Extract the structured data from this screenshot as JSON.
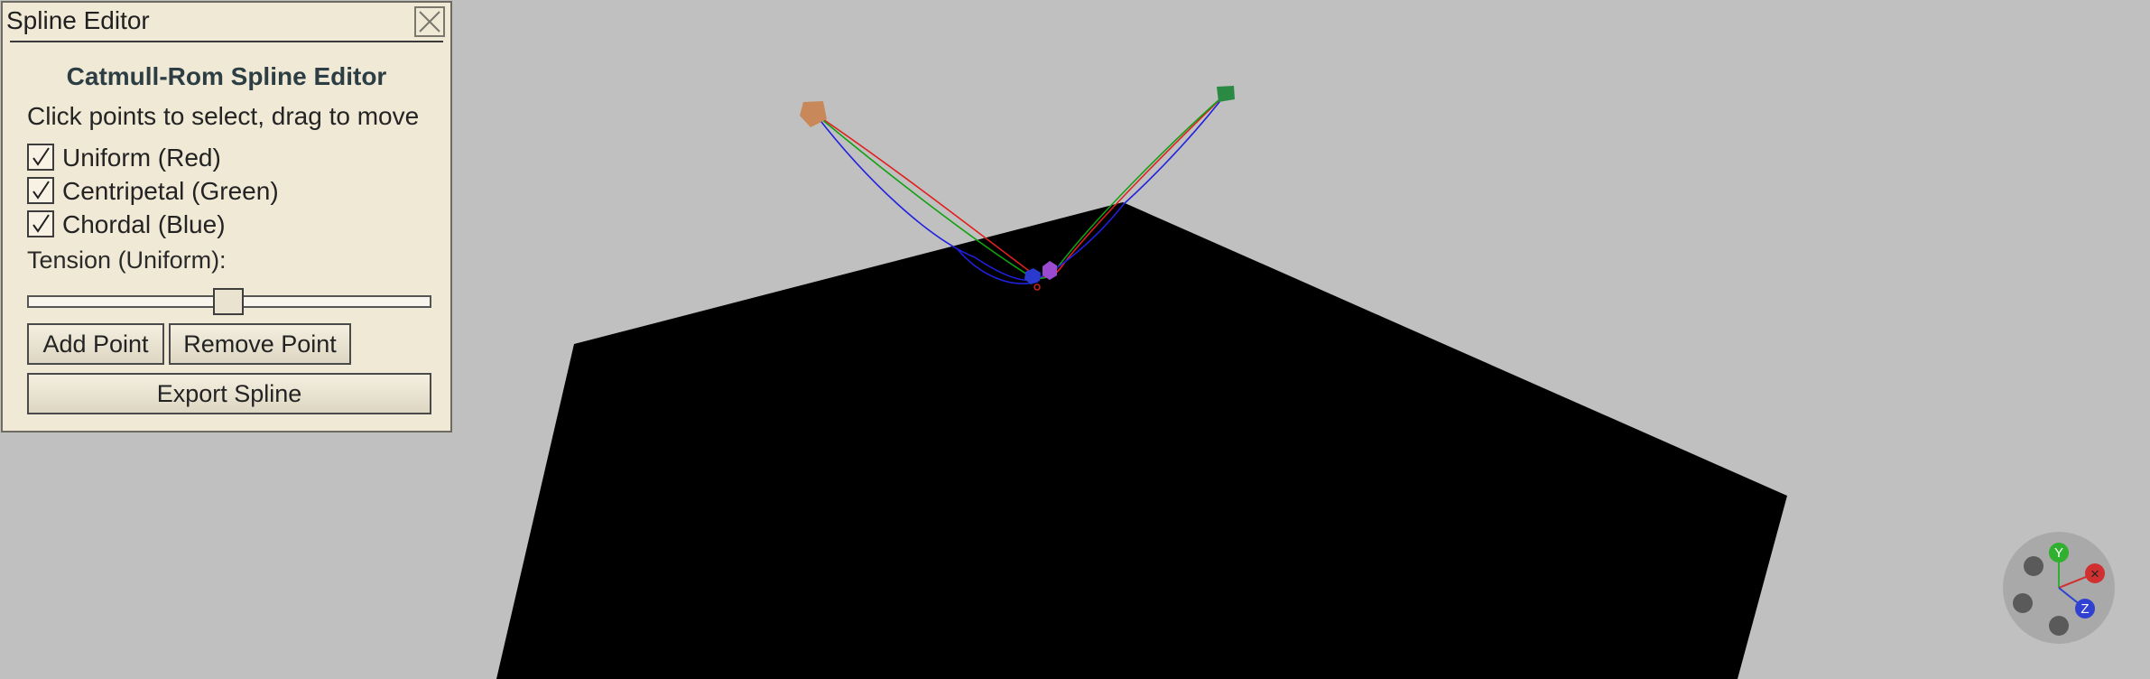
{
  "panel": {
    "title": "Spline Editor",
    "close_icon": "close-icon",
    "heading": "Catmull-Rom Spline Editor",
    "hint": "Click points to select, drag to move",
    "checkboxes": [
      {
        "label": "Uniform (Red)",
        "checked": true
      },
      {
        "label": "Centripetal (Green)",
        "checked": true
      },
      {
        "label": "Chordal (Blue)",
        "checked": true
      }
    ],
    "tension_label": "Tension (Uniform):",
    "tension_value": 0.5,
    "add_point_label": "Add Point",
    "remove_point_label": "Remove Point",
    "export_label": "Export Spline"
  },
  "scene": {
    "background": "#c0c0c0",
    "ground_color": "#000000",
    "curve_colors": {
      "uniform": "#e02020",
      "centripetal": "#10a010",
      "chordal": "#2020e0"
    },
    "control_point_colors": [
      "#c8885a",
      "#2a8a44",
      "#9b4bd0",
      "#2a3acf"
    ]
  },
  "gizmo": {
    "y_label": "Y",
    "z_label": "Z",
    "x_label": "×",
    "colors": {
      "x": "#d03030",
      "y": "#2fb02f",
      "z": "#3040d0",
      "neutral": "#5a5a5a",
      "body": "#a9a9a9"
    }
  }
}
